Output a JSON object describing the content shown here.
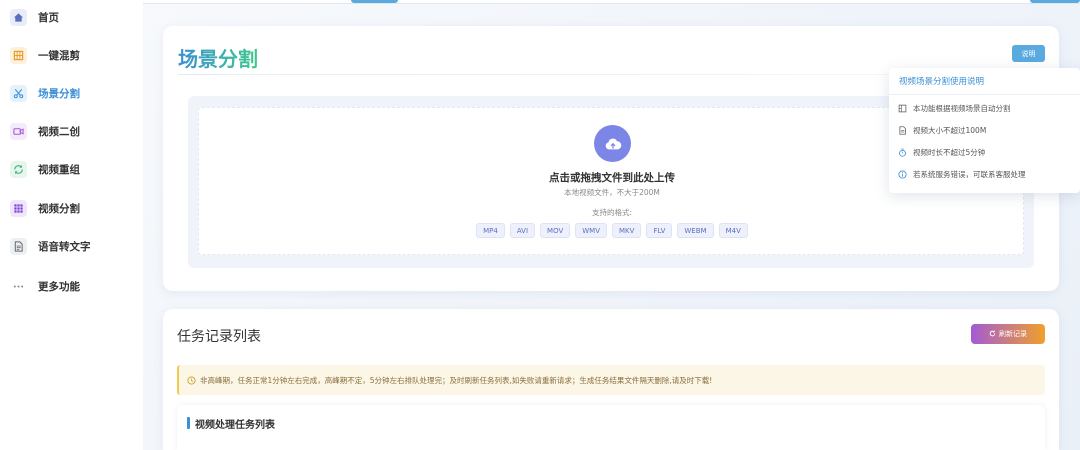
{
  "sidebar": {
    "items": [
      {
        "label": "首页",
        "icon": "home-icon"
      },
      {
        "label": "一键混剪",
        "icon": "grid-film-icon"
      },
      {
        "label": "场景分割",
        "icon": "scissors-icon"
      },
      {
        "label": "视频二创",
        "icon": "video-camera-icon"
      },
      {
        "label": "视频重组",
        "icon": "refresh-icon"
      },
      {
        "label": "视频分割",
        "icon": "grid-icon"
      },
      {
        "label": "语音转文字",
        "icon": "document-icon"
      },
      {
        "label": "更多功能",
        "icon": "more-dots-icon"
      }
    ],
    "active": "场景分割"
  },
  "header": {
    "title": "场景分割",
    "help_label": "说明"
  },
  "upload": {
    "title": "点击或拖拽文件到此处上传",
    "subtitle": "本地视频文件，不大于200M",
    "formats_label": "支持的格式:",
    "formats": [
      "MP4",
      "AVI",
      "MOV",
      "WMV",
      "MKV",
      "FLV",
      "WEBM",
      "M4V"
    ]
  },
  "help_popover": {
    "title": "视频场景分割使用说明",
    "items": [
      {
        "text": "本功能根据视频场景自动分割",
        "icon": "film-icon"
      },
      {
        "text": "视频大小不超过100M",
        "icon": "file-icon"
      },
      {
        "text": "视频时长不超过5分钟",
        "icon": "timer-icon"
      },
      {
        "text": "若系统服务错误，可联系客服处理",
        "icon": "info-icon"
      }
    ]
  },
  "tasks": {
    "title": "任务记录列表",
    "refresh_label": "刷新记录",
    "notice": "非高峰期，任务正常1分钟左右完成，高峰期不定，5分钟左右排队处理完；及时刷新任务列表,如失败请重新请求；生成任务结果文件隔天删除,请及时下载!",
    "list_title": "视频处理任务列表"
  },
  "colors": {
    "accent": "#3a8fd6",
    "title_gradient_end": "#3cc98b",
    "upload_icon": "#7b86e6",
    "notice_bg": "#fbf6e6"
  }
}
